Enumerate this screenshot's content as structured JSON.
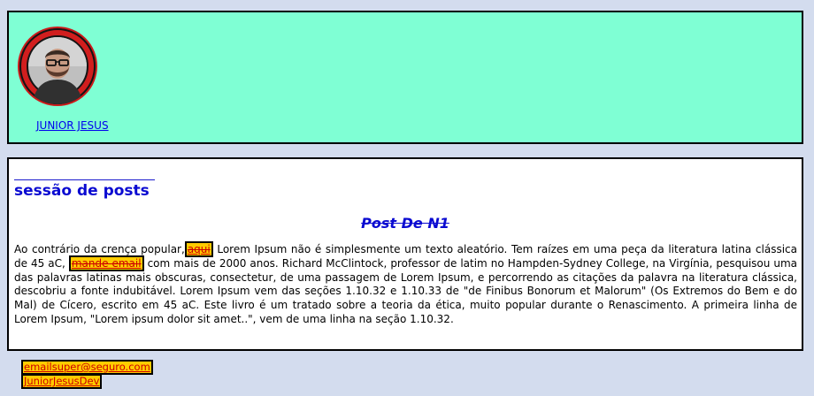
{
  "header": {
    "name": "JUNIOR JESUS"
  },
  "main": {
    "section_title": "sessão de posts",
    "post_title": "Post De N1",
    "body_part1": "Ao contrário da crença popular,",
    "link1": "aqui",
    "body_part2": " Lorem Ipsum não é simplesmente um texto aleatório. Tem raízes em uma peça da literatura latina clássica de 45 aC, ",
    "link2": "mande email",
    "body_part3": " com mais de 2000 anos. Richard McClintock, professor de latim no Hampden-Sydney College, na Virgínia, pesquisou uma das palavras latinas mais obscuras, consectetur, de uma passagem de Lorem Ipsum, e percorrendo as citações da palavra na literatura clássica, descobriu a fonte indubitável. Lorem Ipsum vem das seções 1.10.32 e 1.10.33 de \"de Finibus Bonorum et Malorum\" (Os Extremos do Bem e do Mal) de Cícero, escrito em 45 aC. Este livro é um tratado sobre a teoria da ética, muito popular durante o Renascimento. A primeira linha de Lorem Ipsum, \"Lorem ipsum dolor sit amet..\", vem de uma linha na seção 1.10.32."
  },
  "footer": {
    "email": "emailsuper@seguro.com",
    "username": "JuniorJesusDev"
  },
  "colors": {
    "header_bg": "#7fffd4",
    "page_bg": "#d3dcee",
    "title_blue": "#0a0ad1",
    "highlight": "#ffcc00",
    "link_red": "#cc0000"
  }
}
